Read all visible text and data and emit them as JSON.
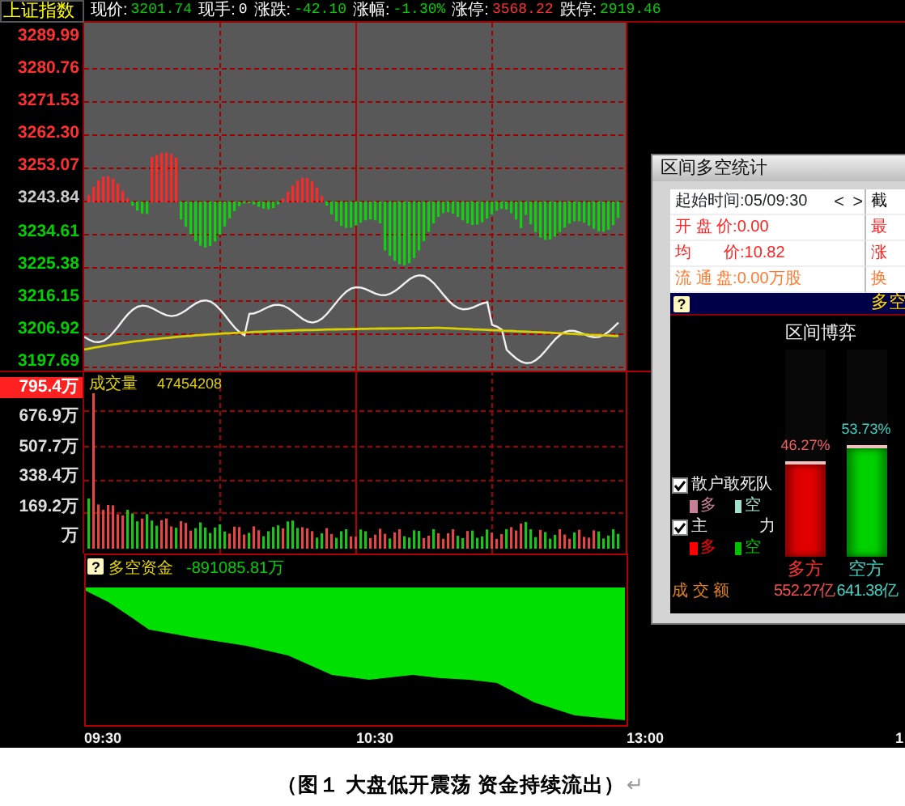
{
  "quote_bar": {
    "index_name": "上证指数",
    "fields": [
      {
        "label": "现价:",
        "value": "3201.74",
        "color": "#00d000"
      },
      {
        "label": "现手:",
        "value": "0",
        "color": "#ffffff"
      },
      {
        "label": "涨跌:",
        "value": "-42.10",
        "color": "#00d000"
      },
      {
        "label": "涨幅:",
        "value": "-1.30%",
        "color": "#00d000"
      },
      {
        "label": "涨停:",
        "value": "3568.22",
        "color": "#ff3030"
      },
      {
        "label": "跌停:",
        "value": "2919.46",
        "color": "#00d000"
      }
    ]
  },
  "price_axis": [
    {
      "text": "3289.99",
      "color": "#ff3030"
    },
    {
      "text": "3280.76",
      "color": "#ff3030"
    },
    {
      "text": "3271.53",
      "color": "#ff3030"
    },
    {
      "text": "3262.30",
      "color": "#ff3030"
    },
    {
      "text": "3253.07",
      "color": "#ff3030"
    },
    {
      "text": "3243.84",
      "color": "#c8c8c8"
    },
    {
      "text": "3234.61",
      "color": "#00d000"
    },
    {
      "text": "3225.38",
      "color": "#00d000"
    },
    {
      "text": "3216.15",
      "color": "#00d000"
    },
    {
      "text": "3206.92",
      "color": "#00d000"
    },
    {
      "text": "3197.69",
      "color": "#00d000"
    }
  ],
  "volume_panel": {
    "title": "成交量",
    "value": "47454208",
    "axis": [
      {
        "text": "795.4万",
        "highlighted": true
      },
      {
        "text": "676.9万",
        "highlighted": false
      },
      {
        "text": "507.7万",
        "highlighted": false
      },
      {
        "text": "338.4万",
        "highlighted": false
      },
      {
        "text": "169.2万",
        "highlighted": false
      },
      {
        "text": "万",
        "highlighted": false
      }
    ]
  },
  "capital_panel": {
    "help_icon": "?",
    "title": "多空资金",
    "value": "-891085.81万"
  },
  "time_axis": [
    "09:30",
    "10:30",
    "13:00",
    "1"
  ],
  "dialog": {
    "title": "区间多空统计",
    "start_time": "起始时间:05/09:30",
    "prev": "<",
    "next": ">",
    "info_rows": [
      {
        "text": "开 盘 价:0.00",
        "color": "#ff2020"
      },
      {
        "text": "均　　价:10.82",
        "color": "#ff2020"
      },
      {
        "text": "流 通 盘:0.00万股",
        "color": "#ff7a30"
      }
    ],
    "right_column": [
      {
        "text": "截",
        "color": "#000000"
      },
      {
        "text": "最",
        "color": "#ff2020"
      },
      {
        "text": "涨",
        "color": "#ff2020"
      },
      {
        "text": "换",
        "color": "#ff7a30"
      }
    ],
    "panel": {
      "help_icon": "?",
      "header": "多空",
      "title": "区间博弈",
      "legend": [
        {
          "label": "散户敢死队",
          "checked": true,
          "swatches": [
            {
              "label": "多",
              "color": "#c88098"
            },
            {
              "label": "空",
              "color": "#a0e0cc"
            }
          ]
        },
        {
          "label": "主　力",
          "checked": true,
          "swatches": [
            {
              "label": "多",
              "color": "#ff0000"
            },
            {
              "label": "空",
              "color": "#00c000"
            }
          ]
        }
      ],
      "sides": [
        {
          "percent": "46.27%",
          "level": 0.4627,
          "color": "#e00000",
          "label": "多方",
          "amount": "552.27亿"
        },
        {
          "percent": "53.73%",
          "level": 0.5373,
          "color": "#00d000",
          "label": "空方",
          "amount": "641.38亿"
        }
      ],
      "amount_label": "成 交 额"
    }
  },
  "caption": {
    "text": "（图１ 大盘低开震荡 资金持续流出）",
    "paragraph_mark": "↵"
  }
}
